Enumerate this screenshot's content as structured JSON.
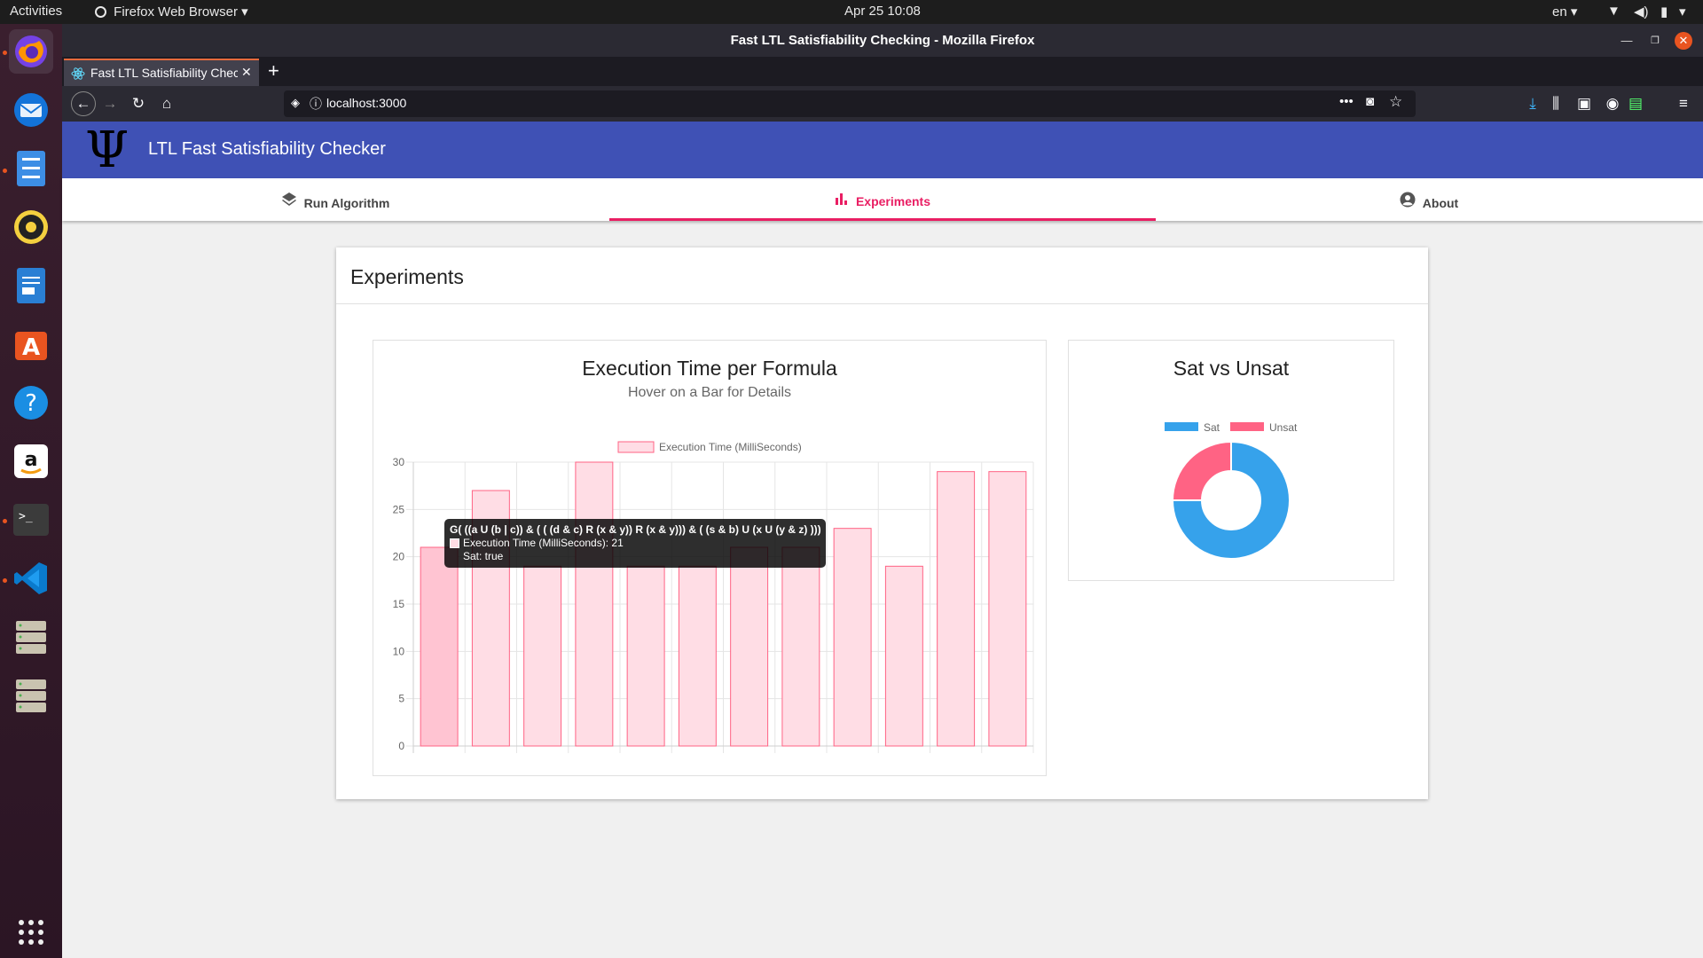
{
  "topbar": {
    "activities": "Activities",
    "app_menu": "Firefox Web Browser",
    "clock": "Apr 25  10:08",
    "lang": "en"
  },
  "window": {
    "title": "Fast LTL Satisfiability Checking - Mozilla Firefox"
  },
  "tab": {
    "label": "Fast LTL Satisfiability Checking"
  },
  "navbar": {
    "url": "localhost:3000"
  },
  "app": {
    "title": "LTL Fast Satisfiability Checker",
    "tabs": [
      {
        "label": "Run Algorithm",
        "icon": "layers-icon"
      },
      {
        "label": "Experiments",
        "icon": "bar-chart-icon"
      },
      {
        "label": "About",
        "icon": "account-circle-icon"
      }
    ],
    "card_title": "Experiments"
  },
  "tooltip": {
    "formula": "G( ((a U (b | c)) & ( ( (d & c) R (x & y)) R (x & y))) & ( (s & b) U (x U (y & z) )))",
    "value_line": "Execution Time (MilliSeconds): 21",
    "sat_line": "Sat: true"
  },
  "colors": {
    "appbar": "#3f51b5",
    "accent": "#e91e63",
    "bar_fill": "#ffdde5",
    "bar_border": "#ff6384",
    "sat": "#36a2eb",
    "unsat": "#ff6384"
  },
  "chart_data": [
    {
      "type": "bar",
      "title": "Execution Time per Formula",
      "subtitle": "Hover on a Bar for Details",
      "legend_position": "top",
      "grid": true,
      "ylim": [
        0,
        30
      ],
      "yticks": [
        0,
        5,
        10,
        15,
        20,
        25,
        30
      ],
      "series": [
        {
          "name": "Execution Time (MilliSeconds)",
          "values": [
            21,
            27,
            19,
            30,
            19,
            19,
            21,
            21,
            23,
            19,
            29,
            29
          ]
        }
      ]
    },
    {
      "type": "pie",
      "donut": true,
      "title": "Sat vs Unsat",
      "legend_position": "top",
      "labels": [
        "Sat",
        "Unsat"
      ],
      "values": [
        9,
        3
      ]
    }
  ]
}
